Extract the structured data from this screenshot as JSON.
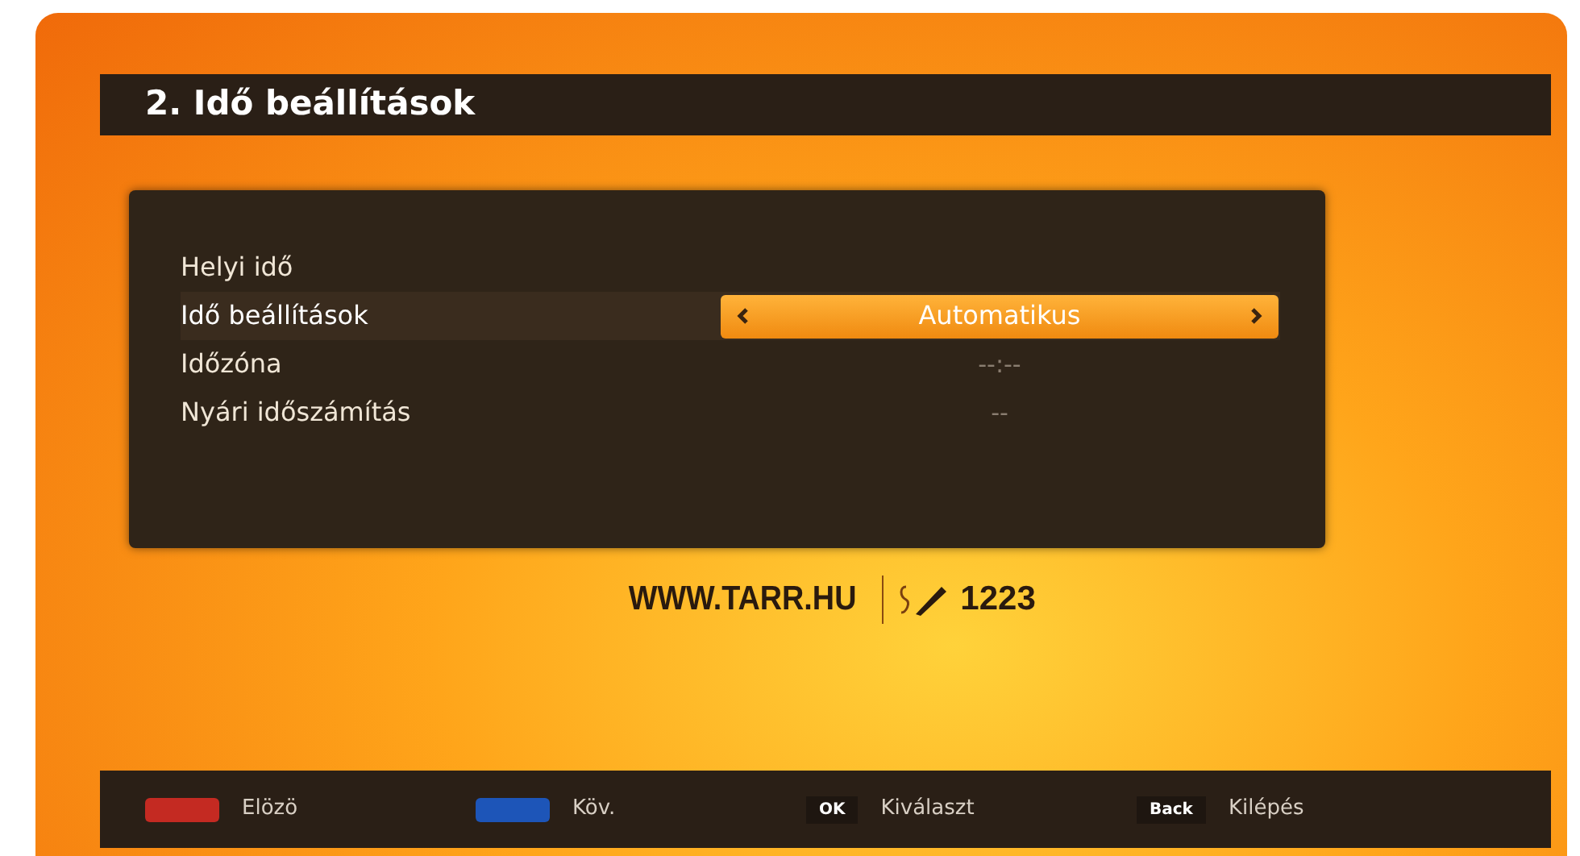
{
  "title": "2. Idő beállítások",
  "rows": [
    {
      "label": "Helyi idő",
      "selected": false
    },
    {
      "label": "Idő beállítások",
      "value": "Automatikus",
      "selected": true
    },
    {
      "label": "Időzóna",
      "value": "--:--",
      "selected": false
    },
    {
      "label": "Nyári időszámítás",
      "value": "--",
      "selected": false
    }
  ],
  "promo": {
    "url": "WWW.TARR.HU",
    "phone": "1223"
  },
  "footer": [
    {
      "kind": "color",
      "color": "#c42a22",
      "label": "Elözö"
    },
    {
      "kind": "color",
      "color": "#1d55b8",
      "label": "Köv."
    },
    {
      "kind": "key",
      "key": "OK",
      "label": "Kiválaszt"
    },
    {
      "kind": "key",
      "key": "Back",
      "label": "Kilépés"
    }
  ]
}
